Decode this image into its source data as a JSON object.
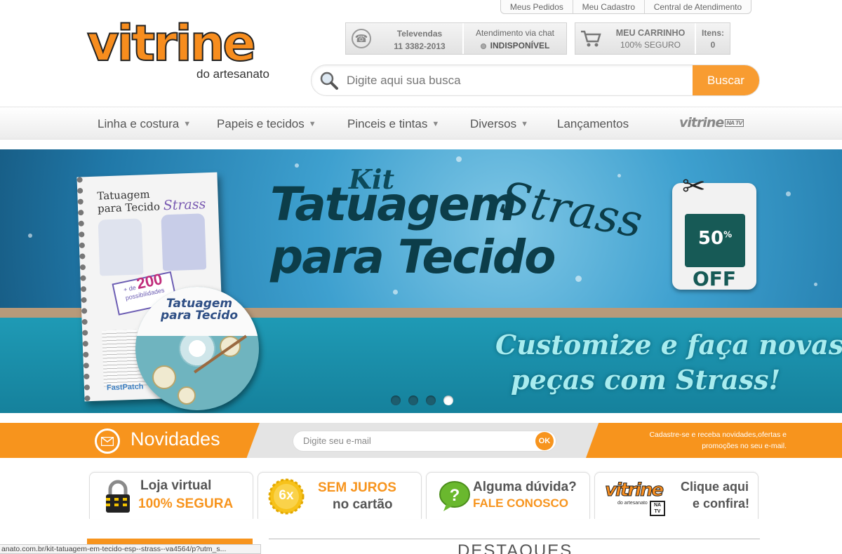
{
  "top_links": [
    "Meus Pedidos",
    "Meu Cadastro",
    "Central de Atendimento"
  ],
  "logo": {
    "word": "vitrine",
    "sub": "do artesanato"
  },
  "televendas": {
    "label": "Televendas",
    "phone": "11 3382-2013"
  },
  "chat": {
    "label": "Atendimento via chat",
    "status": "INDISPONÍVEL"
  },
  "cart": {
    "title": "MEU CARRINHO",
    "subtitle": "100% SEGURO",
    "items_label": "Itens:",
    "items_count": "0"
  },
  "search": {
    "placeholder": "Digite aqui sua busca",
    "button": "Buscar"
  },
  "nav": {
    "items": [
      "Linha e costura",
      "Papeis e tecidos",
      "Pinceis e tintas",
      "Diversos",
      "Lançamentos"
    ],
    "tv": "vitrine",
    "tv_badge": "NA TV"
  },
  "banner": {
    "kit": "Kit",
    "title_line1": "Tatuagem",
    "title_line2": "para Tecido",
    "title_script": "Strass",
    "discount": "50",
    "discount_unit": "%",
    "discount_off": "OFF",
    "cta_line1": "Customize e faça novas",
    "cta_line2": "peças com Strass!",
    "book_title_1": "Tatuagem",
    "book_title_2": "para Tecido",
    "book_title_script": "Strass",
    "book_badge_prefix": "+ de",
    "book_badge_number": "200",
    "book_badge_suffix": "possibilidades",
    "book_logo": "FastPatch",
    "disc_title_1": "Tatuagem",
    "disc_title_2": "para Tecido",
    "slides_total": 4,
    "active_slide": 4
  },
  "newsletter": {
    "title": "Novidades",
    "placeholder": "Digite seu e-mail",
    "ok": "OK",
    "info": "Cadastre-se e receba novidades,ofertas e promoções no seu e-mail."
  },
  "features": [
    {
      "line1": "Loja virtual",
      "line2": "100% SEGURA"
    },
    {
      "badge": "6x",
      "line1": "SEM JUROS",
      "line2": "no cartão"
    },
    {
      "line1": "Alguma dúvida?",
      "line2": "FALE CONOSCO"
    },
    {
      "logo_word": "vitrine",
      "logo_sub": "do artesanato",
      "logo_badge": "NA TV",
      "line1": "Clique aqui",
      "line2": "e confira!"
    }
  ],
  "destaques": "DESTAQUES",
  "status_url": "anato.com.br/kit-tatuagem-em-tecido-esp--strass--va4564/p?utm_s..."
}
